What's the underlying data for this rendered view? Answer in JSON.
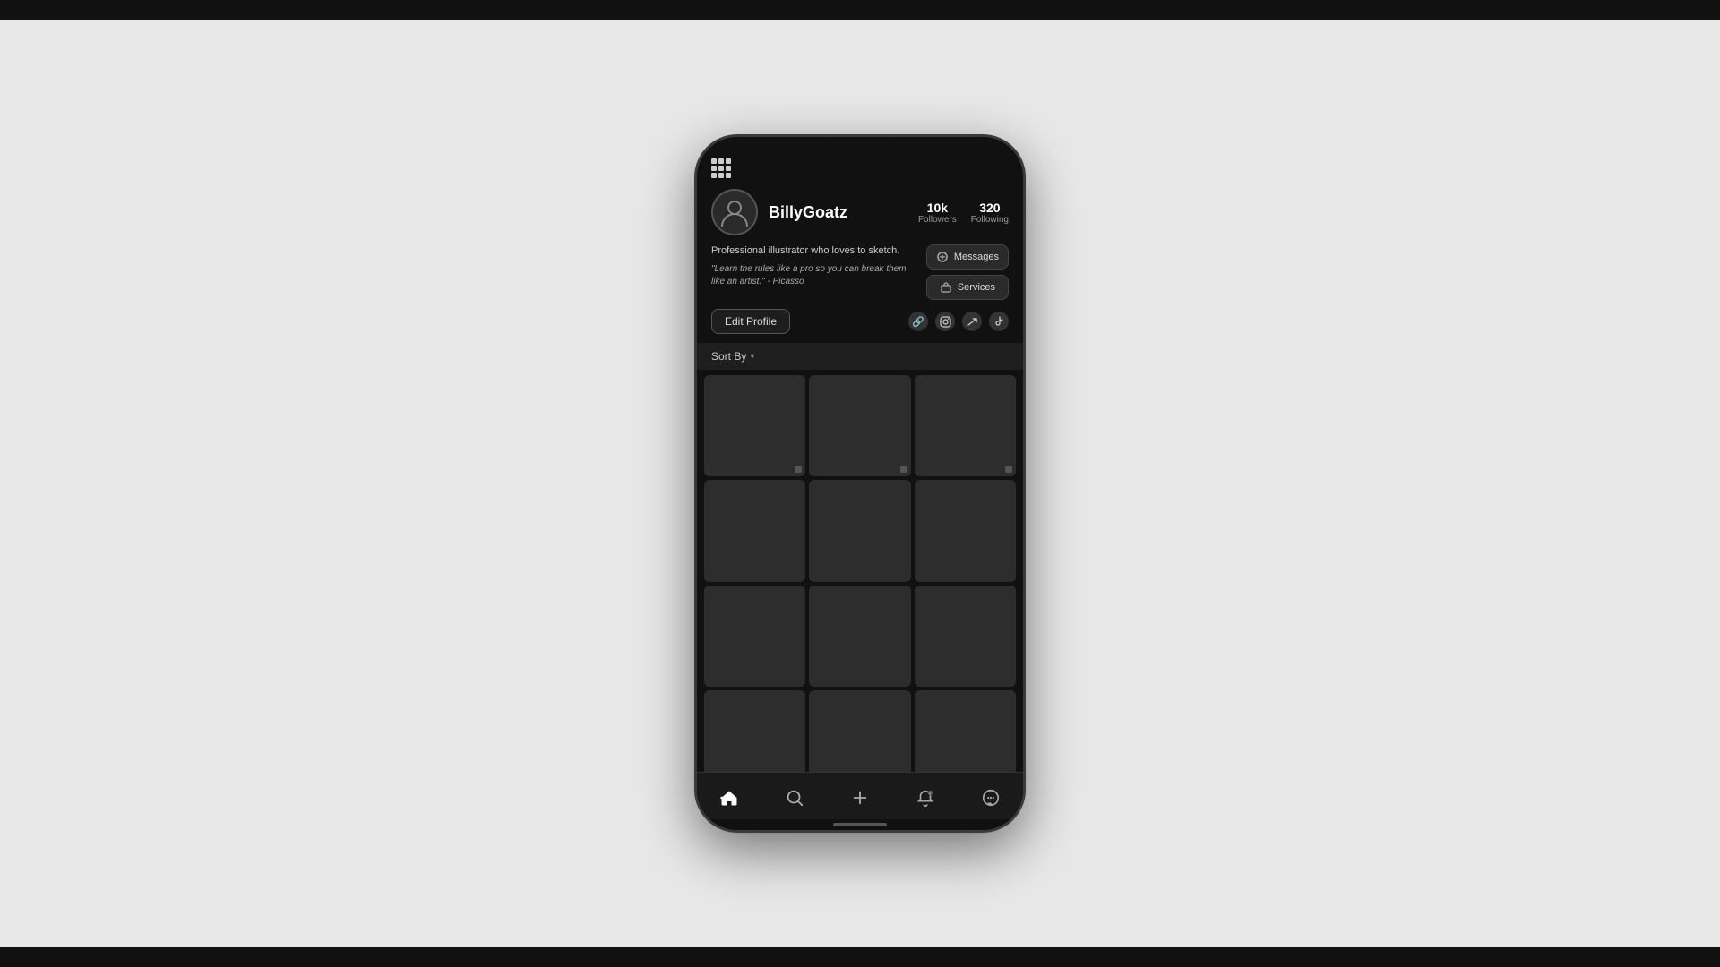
{
  "page": {
    "background_color": "#e8e8e8"
  },
  "header": {
    "grid_icon_label": "menu"
  },
  "profile": {
    "username": "BillyGoatz",
    "followers_count": "10k",
    "followers_label": "Followers",
    "following_count": "320",
    "following_label": "Following",
    "bio_description": "Professional illustrator who loves to sketch.",
    "bio_quote": "\"Learn the rules like a pro so you can break them like an artist.\" - Picasso",
    "edit_profile_label": "Edit Profile",
    "messages_label": "Messages",
    "services_label": "Services"
  },
  "social": {
    "icons": [
      "🔗",
      "📷",
      "🐦",
      "♪"
    ]
  },
  "sort_bar": {
    "label": "Sort By",
    "chevron": "▾"
  },
  "grid": {
    "items": [
      {
        "id": 1
      },
      {
        "id": 2
      },
      {
        "id": 3
      },
      {
        "id": 4
      },
      {
        "id": 5
      },
      {
        "id": 6
      },
      {
        "id": 7
      },
      {
        "id": 8
      },
      {
        "id": 9
      },
      {
        "id": 10
      },
      {
        "id": 11
      },
      {
        "id": 12
      }
    ]
  },
  "nav": {
    "items": [
      {
        "name": "home",
        "icon": "🏠",
        "active": true
      },
      {
        "name": "search",
        "icon": "🔍",
        "active": false
      },
      {
        "name": "add",
        "icon": "➕",
        "active": false
      },
      {
        "name": "notifications",
        "icon": "🔔",
        "active": false
      },
      {
        "name": "profile",
        "icon": "💬",
        "active": false
      }
    ]
  }
}
